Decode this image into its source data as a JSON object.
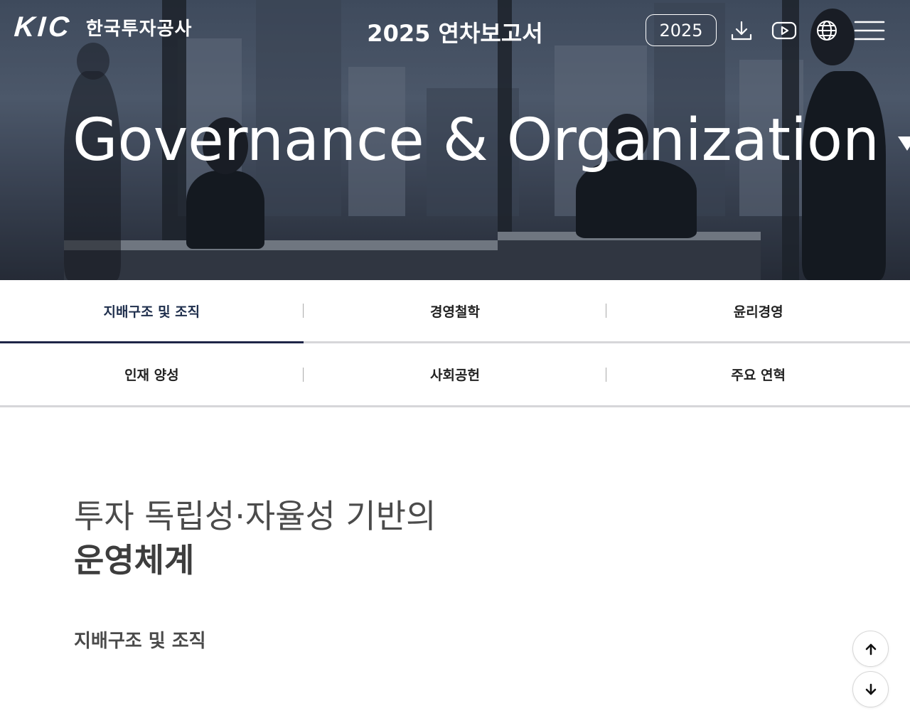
{
  "header": {
    "logo_text": "KIC",
    "logo_korean": "한국투자공사",
    "report_title": "2025 연차보고서",
    "year_button": "2025",
    "icons": [
      "download-icon",
      "youtube-icon",
      "globe-icon",
      "menu-icon"
    ]
  },
  "hero": {
    "title": "Governance & Organization"
  },
  "tabs": {
    "row1": [
      {
        "label": "지배구조 및 조직",
        "active": true
      },
      {
        "label": "경영철학",
        "active": false
      },
      {
        "label": "윤리경영",
        "active": false
      }
    ],
    "row2": [
      {
        "label": "인재 양성",
        "active": false
      },
      {
        "label": "사회공헌",
        "active": false
      },
      {
        "label": "주요 연혁",
        "active": false
      }
    ]
  },
  "main": {
    "headline_line1": "투자 독립성·자율성 기반의",
    "headline_line2": "운영체계",
    "section_label": "지배구조 및 조직"
  },
  "colors": {
    "active_tab_underline": "#1e2547",
    "tab_border": "#d6d6d9",
    "headline_text": "#4b4b4b"
  },
  "floating": {
    "icons": [
      "arrow-up-icon",
      "arrow-down-icon"
    ]
  }
}
